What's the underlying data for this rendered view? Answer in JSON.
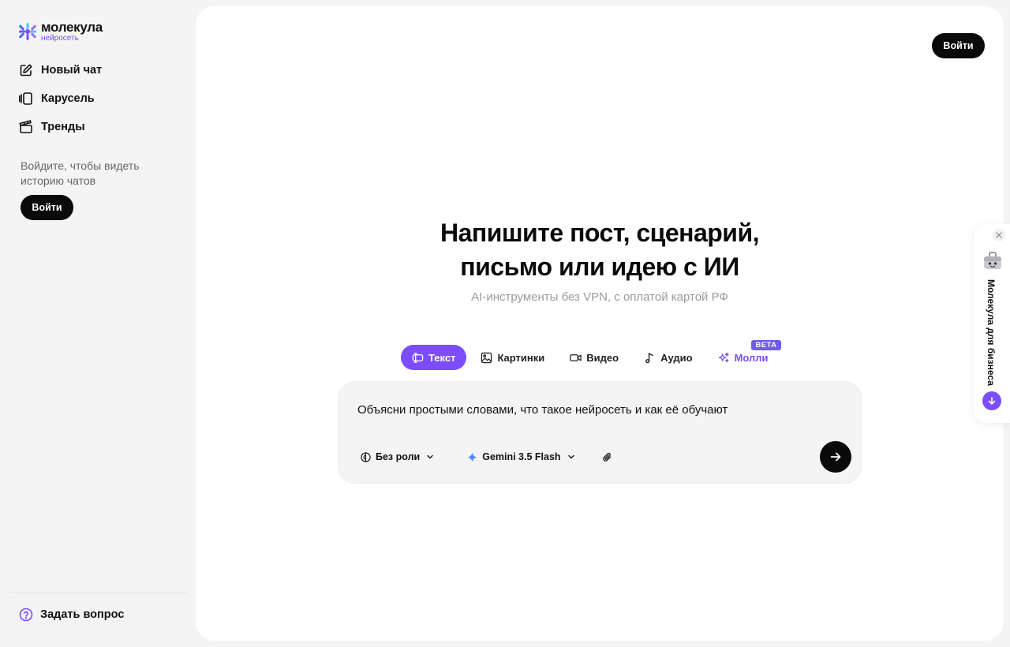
{
  "brand": {
    "name": "молекула",
    "tagline": "нейросеть"
  },
  "sidebar": {
    "items": [
      {
        "label": "Новый чат",
        "icon": "edit-icon"
      },
      {
        "label": "Карусель",
        "icon": "carousel-icon"
      },
      {
        "label": "Тренды",
        "icon": "clapperboard-icon"
      }
    ],
    "login_hint": "Войдите, чтобы видеть историю чатов",
    "login_button": "Войти",
    "help_label": "Задать вопрос"
  },
  "header": {
    "login_button": "Войти"
  },
  "hero": {
    "title_line1": "Напишите пост, сценарий,",
    "title_line2": "письмо или идею с ИИ",
    "subtitle": "AI-инструменты без VPN, с оплатой картой РФ"
  },
  "tabs": [
    {
      "label": "Текст",
      "icon": "text-icon",
      "active": true
    },
    {
      "label": "Картинки",
      "icon": "image-icon"
    },
    {
      "label": "Видео",
      "icon": "video-icon"
    },
    {
      "label": "Аудио",
      "icon": "music-icon"
    },
    {
      "label": "Молли",
      "icon": "sparkles-icon",
      "badge": "BETA"
    }
  ],
  "composer": {
    "text": "Объясни простыми словами, что такое нейросеть и как её обучают",
    "role_label": "Без роли",
    "model_label": "Gemini 3.5 Flash"
  },
  "biz_widget": {
    "label": "Молекула для бизнеса"
  },
  "colors": {
    "accent": "#7c4dff",
    "dark": "#0a0a0a",
    "sidebar_bg": "#f4f4f5"
  }
}
